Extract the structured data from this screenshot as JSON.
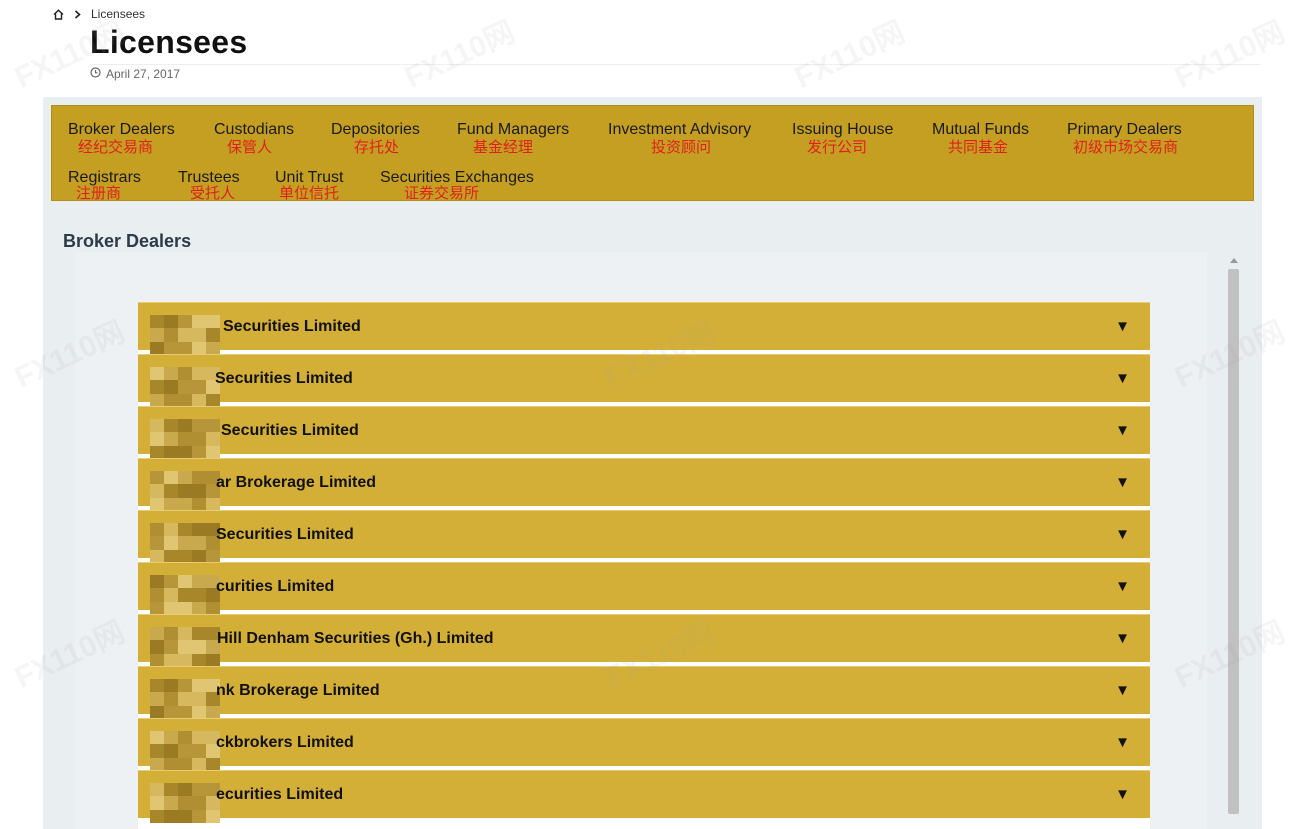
{
  "breadcrumb": {
    "current": "Licensees"
  },
  "page": {
    "title": "Licensees",
    "date": "April 27, 2017"
  },
  "categories": [
    {
      "en": "Broker Dealers",
      "zh": "经纪交易商"
    },
    {
      "en": "Custodians",
      "zh": "保管人"
    },
    {
      "en": "Depositories",
      "zh": "存托处"
    },
    {
      "en": "Fund Managers",
      "zh": "基金经理"
    },
    {
      "en": "Investment Advisory",
      "zh": "投资顾问"
    },
    {
      "en": "Issuing House",
      "zh": "发行公司"
    },
    {
      "en": "Mutual Funds",
      "zh": "共同基金"
    },
    {
      "en": "Primary Dealers",
      "zh": "初级市场交易商"
    },
    {
      "en": "Registrars",
      "zh": "注册商"
    },
    {
      "en": "Trustees",
      "zh": "受托人"
    },
    {
      "en": "Unit Trust",
      "zh": "单位信托"
    },
    {
      "en": "Securities Exchanges",
      "zh": "证券交易所"
    }
  ],
  "section": {
    "heading": "Broker Dealers"
  },
  "brokers": [
    {
      "name": "Securities Limited"
    },
    {
      "name": "Securities Limited"
    },
    {
      "name": "Securities Limited"
    },
    {
      "name": "ar Brokerage Limited"
    },
    {
      "name": "Securities Limited"
    },
    {
      "name": "curities Limited"
    },
    {
      "name": "Hill Denham Securities (Gh.) Limited"
    },
    {
      "name": "nk Brokerage Limited"
    },
    {
      "name": "ckbrokers Limited"
    },
    {
      "name": "ecurities Limited"
    }
  ],
  "expand_glyph": "▼",
  "watermark": "FX110网",
  "colors": {
    "nav_bg": "#c49f22",
    "row_bg": "#d4af37",
    "zh_text": "#e0201c",
    "panel_bg": "#e9eef0"
  }
}
